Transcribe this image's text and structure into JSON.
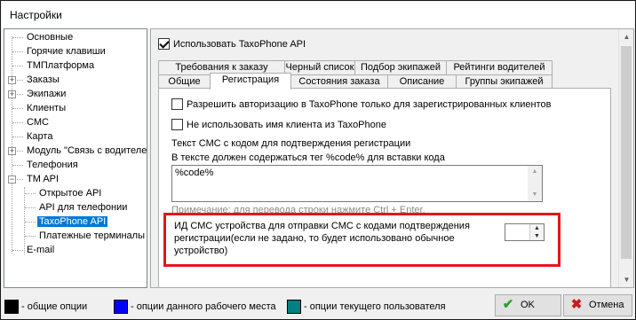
{
  "window": {
    "title": "Настройки"
  },
  "tree": {
    "items": [
      {
        "label": "Основные"
      },
      {
        "label": "Горячие клавиши"
      },
      {
        "label": "ТМПлатформа"
      },
      {
        "label": "Заказы"
      },
      {
        "label": "Экипажи"
      },
      {
        "label": "Клиенты"
      },
      {
        "label": "СМС"
      },
      {
        "label": "Карта"
      },
      {
        "label": "Модуль \"Связь с водителе"
      },
      {
        "label": "Телефония"
      },
      {
        "label": "TM API"
      },
      {
        "label": "Открытое API"
      },
      {
        "label": "API для телефонии"
      },
      {
        "label": "TaxoPhone API"
      },
      {
        "label": "Платежные терминалы"
      },
      {
        "label": "E-mail"
      }
    ],
    "expander_plus": "+",
    "expander_minus": "−"
  },
  "main": {
    "use_api_label": "Использовать TaxoPhone API",
    "use_api_checked": true,
    "tabs_row1": [
      {
        "label": "Требования к заказу"
      },
      {
        "label": "Черный список"
      },
      {
        "label": "Подбор экипажей"
      },
      {
        "label": "Рейтинги водителей"
      }
    ],
    "tabs_row2": [
      {
        "label": "Общие"
      },
      {
        "label": "Регистрация"
      },
      {
        "label": "Состояния заказа"
      },
      {
        "label": "Описание"
      },
      {
        "label": "Группы экипажей"
      }
    ],
    "active_tab": "Регистрация",
    "registration": {
      "allow_registered_only_label": "Разрешить авторизацию в TaxoPhone только для зарегистрированных клиентов",
      "allow_registered_only_checked": false,
      "no_client_name_label": "Не использовать имя клиента из TaxoPhone",
      "no_client_name_checked": false,
      "sms_text_label": "Текст СМС с кодом для подтверждения регистрации",
      "sms_text_hint": "В тексте должен содержаться тег %code% для вставки кода",
      "sms_text_value": "%code%",
      "sms_note": "Примечание: для перевода строки нажмите Ctrl + Enter.",
      "sms_device_label_line1": "ИД СМС устройства для отправки СМС с кодами подтверждения",
      "sms_device_label_line2": "регистрации(если не задано, то будет использовано обычное",
      "sms_device_label_line3": "устройство)",
      "sms_device_value": ""
    }
  },
  "legend": [
    {
      "label": "- общие опции",
      "color": "#000000"
    },
    {
      "label": "- опции данного рабочего места",
      "color": "#0000ff"
    },
    {
      "label": "- опции текущего пользователя",
      "color": "#008080"
    }
  ],
  "buttons": {
    "ok_label": "OK",
    "cancel_label": "Отмена"
  },
  "icons": {
    "ok": "check-icon",
    "cancel": "close-icon",
    "accent_green": "#2f9e2f",
    "accent_red": "#d01818",
    "highlight": "#e8141c"
  }
}
